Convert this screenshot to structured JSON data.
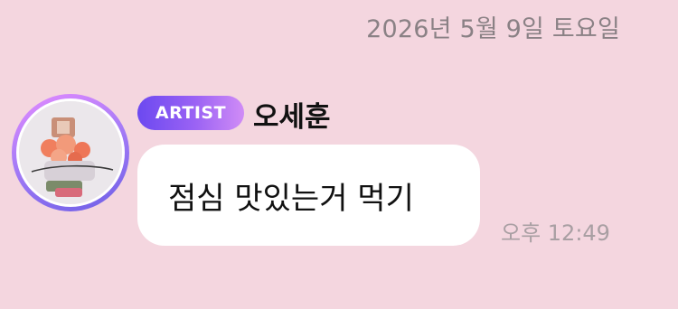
{
  "chat": {
    "date_separator": "2026년 5월 9일 토요일",
    "message": {
      "badge": "ARTIST",
      "sender": "오세훈",
      "text": "점심 맛있는거 먹기",
      "time": "오후 12:49",
      "avatar_icon": "bouquet-photo-avatar"
    }
  },
  "colors": {
    "background": "#f4d6df",
    "bubble": "#ffffff",
    "badge_gradient_start": "#6c49f0",
    "badge_gradient_end": "#d08cf6",
    "timestamp": "#a99fa3",
    "date_text": "#8a8185"
  }
}
